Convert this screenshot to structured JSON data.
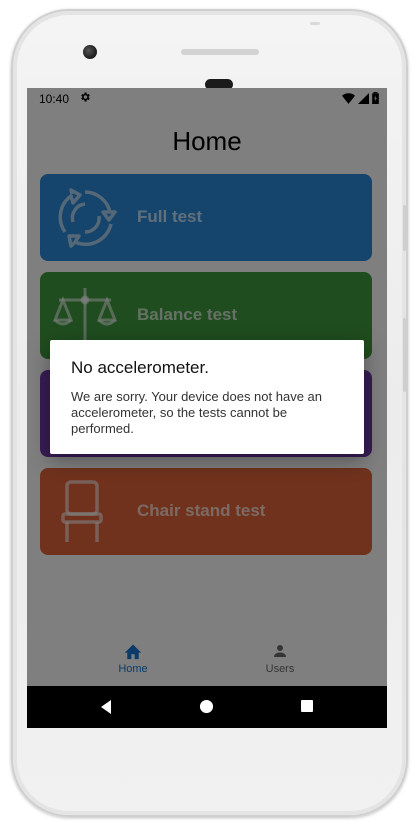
{
  "status_bar": {
    "time": "10:40"
  },
  "header": {
    "title": "Home"
  },
  "cards": [
    {
      "label": "Full test",
      "color": "#2a89d8",
      "icon": "cycle-arrows-icon"
    },
    {
      "label": "Balance test",
      "color": "#3f9a3f",
      "icon": "balance-scale-icon"
    },
    {
      "label": "",
      "color": "#6f3aa8",
      "icon": ""
    },
    {
      "label": "Chair stand test",
      "color": "#e0653a",
      "icon": "chair-icon"
    }
  ],
  "dialog": {
    "title": "No accelerometer.",
    "message": "We are sorry. Your device does not have an accelerometer, so the tests cannot be performed."
  },
  "bottom_nav": {
    "items": [
      {
        "label": "Home",
        "icon": "home-icon",
        "active": true
      },
      {
        "label": "Users",
        "icon": "person-icon",
        "active": false
      }
    ]
  },
  "colors": {
    "accent": "#1976d2",
    "scrim": "rgba(0,0,0,0.5)"
  }
}
